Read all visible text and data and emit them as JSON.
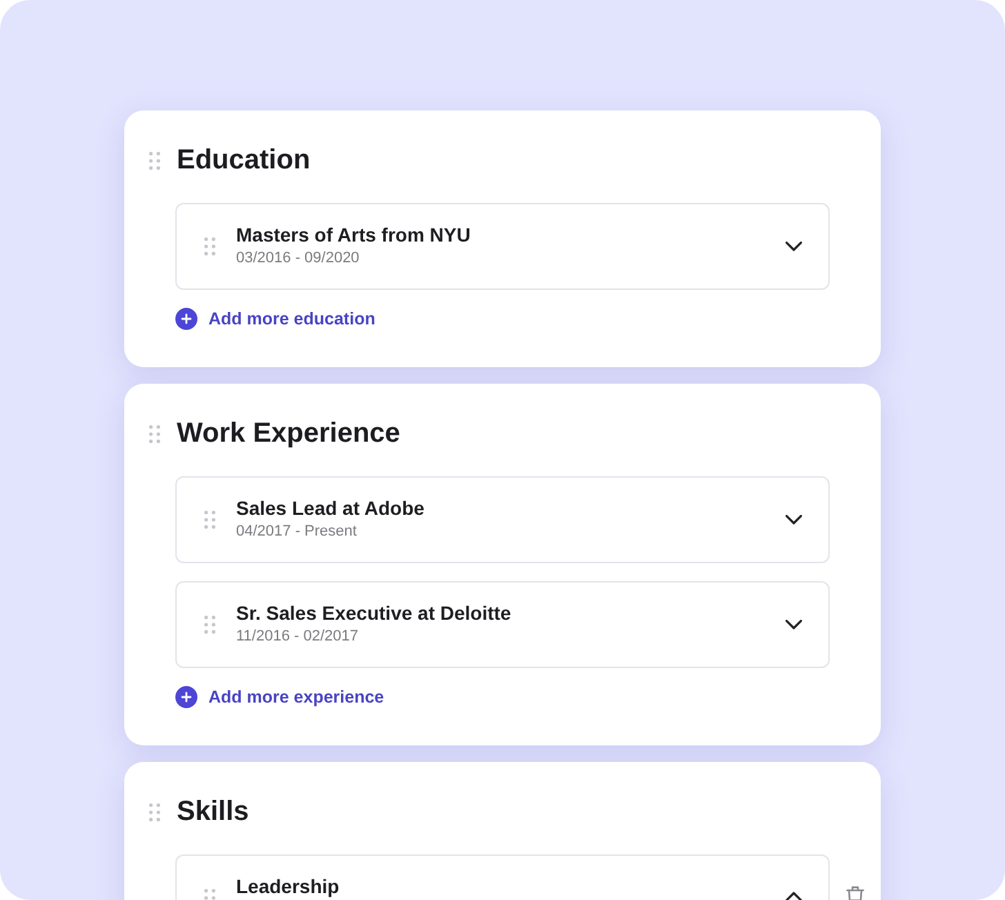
{
  "sections": [
    {
      "title": "Education",
      "entries": [
        {
          "title": "Masters of Arts from NYU",
          "dates": "03/2016 - 09/2020",
          "expanded": false
        }
      ],
      "add_label": "Add more education"
    },
    {
      "title": "Work Experience",
      "entries": [
        {
          "title": "Sales Lead at Adobe",
          "dates": "04/2017 - Present",
          "expanded": false
        },
        {
          "title": "Sr. Sales Executive at Deloitte",
          "dates": "11/2016 - 02/2017",
          "expanded": false
        }
      ],
      "add_label": "Add more experience"
    },
    {
      "title": "Skills",
      "entries": [
        {
          "title": "Leadership",
          "expanded": true
        }
      ]
    }
  ]
}
